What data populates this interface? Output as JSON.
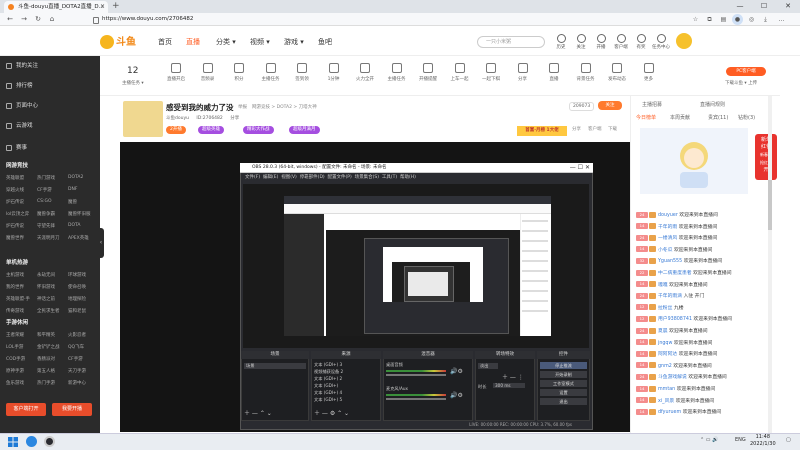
{
  "browser": {
    "tab_title": "斗鱼-douyu直播_DOTA2直播_D...",
    "url": "https://www.douyu.com/2706482",
    "controls": {
      "minimize": "—",
      "maximize": "☐",
      "close": "✕"
    }
  },
  "site": {
    "logo": "斗鱼",
    "nav": [
      "首页",
      "直播",
      "分类 ▾",
      "视频 ▾",
      "游戏 ▾",
      "鱼吧"
    ],
    "active_nav": "直播",
    "search_placeholder": "一只小米粥",
    "header_icons": [
      "历史",
      "关注",
      "开播",
      "客户端",
      "有奖",
      "任务中心"
    ]
  },
  "sidebar": {
    "items": [
      "我的关注",
      "排行榜",
      "页面中心",
      "云游戏",
      "赛事"
    ],
    "section_network": "网游竞技",
    "network_games": [
      "英雄联盟",
      "热门游戏",
      "DOTA2",
      "穿越火线",
      "CF手游",
      "DNF",
      "炉石传说",
      "CS:GO",
      "魔兽",
      "lol云顶之弈",
      "魔兽争霸",
      "魔兽怀旧服",
      "炉石传说",
      "守望先锋",
      "DOTA",
      "魔兽世界",
      "天涯明月刀",
      "APEX英雄"
    ],
    "section_single": "单机热游",
    "single_games": [
      "主机游戏",
      "永劫无间",
      "环球游戏",
      "我的世界",
      "怀旧游戏",
      "使命召唤",
      "英雄联盟·手",
      "神话之前",
      "地理探险",
      "传奇游戏",
      "全民求生者",
      "猫和老鼠"
    ],
    "section_mobile": "手游休闲",
    "mobile_games": [
      "王者荣耀",
      "和平精英",
      "火影忍者",
      "LOL手游",
      "金铲铲之战",
      "QQ飞车",
      "COD手游",
      "香肠派对",
      "CF手游",
      "原神手游",
      "第五人格",
      "天刀手游",
      "鱼乐游戏",
      "热门手游",
      "新游中心"
    ],
    "btn_client": "客户端打开",
    "btn_start": "我要开播"
  },
  "categories": {
    "count": "12",
    "count_sub": "主播任务 ▾",
    "items": [
      "直播开启",
      "音频录",
      "积分",
      "主播任务",
      "签到领",
      "1分钟",
      "火力全开",
      "主播任务",
      "开播提醒",
      "上车一起",
      "一起下棋",
      "分享",
      "直播",
      "背景任务",
      "发布动态",
      "更多"
    ],
    "pc_badge": "PC客户端",
    "pc_sub": "下载斗鱼 ▾ 上传"
  },
  "streamer": {
    "title": "感受到我的威力了没",
    "tag1": "举报",
    "category_path": "网游竞技 > DOTA2 > 刀塔大神",
    "name": "斗鱼douyu",
    "room_label": "ID:2706482",
    "meta2": "分享",
    "followers": "209073",
    "follow_btn": "关注",
    "pills": [
      "2开播",
      "超级英雄",
      "精彩大作战",
      "超级月满月"
    ],
    "rank_badge": "首富·月榜 1大佬",
    "tools": [
      "分享",
      "客户端",
      "下载"
    ]
  },
  "obs": {
    "window_title": "OBS 28.0.3 (64-bit, windows) - 配置文件: 未命名 - 场景: 未命名",
    "menu": [
      "文件(F)",
      "编辑(E)",
      "视图(V)",
      "停靠部件(D)",
      "配置文件(P)",
      "场景集合(S)",
      "工具(T)",
      "帮助(H)"
    ],
    "panels": [
      "场景",
      "来源",
      "混音器",
      "转场特效",
      "控件"
    ],
    "scene_item": "场景",
    "sources": [
      "文本 (GDI+) 3",
      "视频捕获设备 2",
      "文本 (GDI+) 2",
      "文本 (GDI+)",
      "文本 (GDI+) 4",
      "文本 (GDI+) 5"
    ],
    "mixer": [
      "桌面音频",
      "麦克风/Aux"
    ],
    "transition": "淡出",
    "duration_label": "时长",
    "duration": "300 ms",
    "controls": [
      "停止推流",
      "开始录制",
      "工作室模式",
      "设置",
      "退出"
    ],
    "status": "LIVE: 00:00:00   REC: 00:00:00   CPU: 3.7%, 60.00 fps"
  },
  "chat": {
    "tabs": [
      "今日榜单",
      "本周贡献",
      "贵宾(11)",
      "钻粉(3)"
    ],
    "header": "主播招募",
    "header2": "直播间规则",
    "newyear": [
      "新年",
      "红包",
      "新春贺",
      "抢红包",
      "开"
    ],
    "messages": [
      {
        "lv": "24",
        "nick": "douyuer",
        "text": "欢迎来到本直播间"
      },
      {
        "lv": "14",
        "nick": "千年的雨",
        "text": "欢迎来到本直播间"
      },
      {
        "lv": "24",
        "nick": "一缕清风",
        "text": "欢迎来到本直播间"
      },
      {
        "lv": "14",
        "nick": "小冬瓜",
        "text": "欢迎来到本直播间"
      },
      {
        "lv": "32",
        "nick": "Yguan555",
        "text": "欢迎来到本直播间"
      },
      {
        "lv": "22",
        "nick": "中二病重度患者",
        "text": "欢迎来到本直播间"
      },
      {
        "lv": "14",
        "nick": "嘎嘎",
        "text": "欢迎来到本直播间"
      },
      {
        "lv": "24",
        "nick": "千年的雨滴",
        "text": "入驻 开门"
      },
      {
        "lv": "12",
        "nick": "拉粉丝",
        "text": "九楼"
      },
      {
        "lv": "12",
        "nick": "用户93808741",
        "text": "欢迎来到本直播间"
      },
      {
        "lv": "24",
        "nick": "夏晨",
        "text": "欢迎来到本直播间"
      },
      {
        "lv": "14",
        "nick": "jngqw",
        "text": "欢迎来到本直播间"
      },
      {
        "lv": "14",
        "nick": "阿阿阿达",
        "text": "欢迎来到本直播间"
      },
      {
        "lv": "14",
        "nick": "gnm2",
        "text": "欢迎来到本直播间"
      },
      {
        "lv": "24",
        "nick": "斗鱼游戏解说",
        "text": "欢迎来到本直播间"
      },
      {
        "lv": "14",
        "nick": "mmtan",
        "text": "欢迎来到本直播间"
      },
      {
        "lv": "14",
        "nick": "xi_风景",
        "text": "欢迎来到本直播间"
      },
      {
        "lv": "14",
        "nick": "dfyuruem",
        "text": "欢迎来到本直播间"
      }
    ]
  },
  "taskbar": {
    "time": "11:48",
    "date": "2022/1/30",
    "lang": "ENG"
  }
}
